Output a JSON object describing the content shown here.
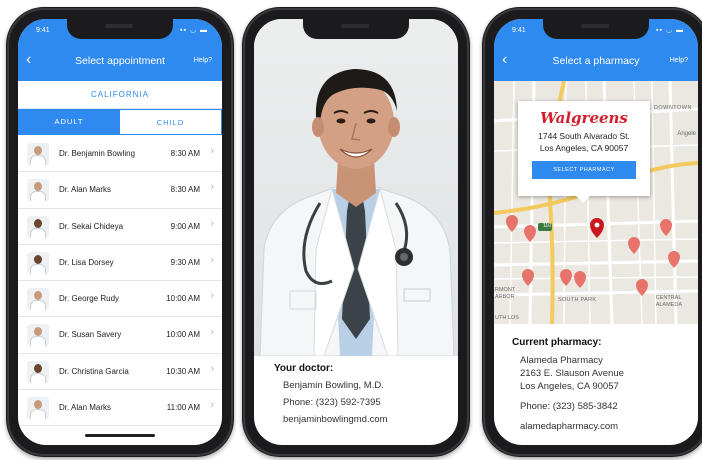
{
  "screen1": {
    "status_time": "9:41",
    "status_icons": "▪▪ ◡ ▬",
    "title": "Select appointment",
    "help": "Help?",
    "back_icon": "‹",
    "state": "CALIFORNIA",
    "tabs": {
      "adult": "ADULT",
      "child": "CHILD"
    },
    "doctors": [
      {
        "name": "Dr. Benjamin Bowling",
        "time": "8:30 AM"
      },
      {
        "name": "Dr. Alan Marks",
        "time": "8:30 AM"
      },
      {
        "name": "Dr. Sekai Chideya",
        "time": "9:00 AM"
      },
      {
        "name": "Dr. Lisa Dorsey",
        "time": "9:30 AM"
      },
      {
        "name": "Dr. George Rudy",
        "time": "10:00 AM"
      },
      {
        "name": "Dr. Susan Savery",
        "time": "10:00 AM"
      },
      {
        "name": "Dr. Christina Garcia",
        "time": "10:30 AM"
      },
      {
        "name": "Dr. Alan Marks",
        "time": "11:00 AM"
      }
    ],
    "chevron": "›"
  },
  "screen2": {
    "label": "Your doctor:",
    "name": "Benjamin Bowling, M.D.",
    "phone": "Phone: (323) 592-7395",
    "website": "benjaminbowlingmd.com"
  },
  "screen3": {
    "status_time": "9:41",
    "status_icons": "▪▪ ◡ ▬",
    "title": "Select a pharmacy",
    "help": "Help?",
    "back_icon": "‹",
    "map_labels": {
      "downtown": "DOWNTOWN",
      "angeles": "Angele",
      "south_park": "SOUTH PARK",
      "central_alameda": "CENTRAL\nALAMEDA",
      "harbor": "RMONT\nARBOR",
      "south_los": "UTH LOS",
      "highway": "110"
    },
    "callout": {
      "brand": "Walgreens",
      "address1": "1744 South Alvarado St.",
      "address2": "Los Angeles, CA 90057",
      "button": "SELECT PHARMACY"
    },
    "current": {
      "label": "Current pharmacy:",
      "name": "Alameda Pharmacy",
      "street": "2163 E. Slauson Avenue",
      "city": "Los Angeles, CA 90057",
      "phone": "Phone: (323) 585-3842",
      "website": "alamedapharmacy.com"
    }
  },
  "colors": {
    "accent": "#2f8af0",
    "brand_red": "#d21f2b",
    "pin": "#e8736b"
  }
}
